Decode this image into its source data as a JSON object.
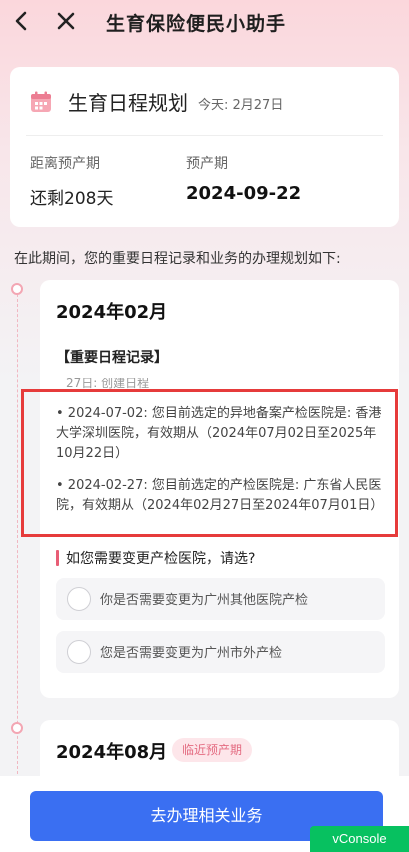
{
  "nav": {
    "title": "生育保险便民小助手"
  },
  "header_card": {
    "title": "生育日程规划",
    "today": "今天: 2月27日",
    "left_label": "距离预产期",
    "left_value": "还剩208天",
    "right_label": "预产期",
    "right_value": "2024-09-22"
  },
  "intro": "在此期间，您的重要日程记录和业务的办理规划如下:",
  "month_card": {
    "month": "2024年02月",
    "section_title": "【重要日程记录】",
    "faded_text": "27日: 创建日程",
    "records": [
      "• 2024-07-02: 您目前选定的异地备案产检医院是: 香港大学深圳医院，有效期从（2024年07月02日至2025年10月22日）",
      "• 2024-02-27: 您目前选定的产检医院是: 广东省人民医院，有效期从（2024年02月27日至2024年07月01日）"
    ],
    "change_prompt": "如您需要变更产检医院，请选?",
    "options": [
      "你是否需要变更为广州其他医院产检",
      "您是否需要变更为广州市外产检"
    ]
  },
  "next_card": {
    "month": "2024年08月",
    "badge": "临近预产期"
  },
  "cta_label": "去办理相关业务",
  "vconsole_label": "vConsole",
  "colors": {
    "accent": "#3a6ff2",
    "pink": "#e85d75",
    "vconsole": "#07c160",
    "highlight": "#e63b3b"
  }
}
